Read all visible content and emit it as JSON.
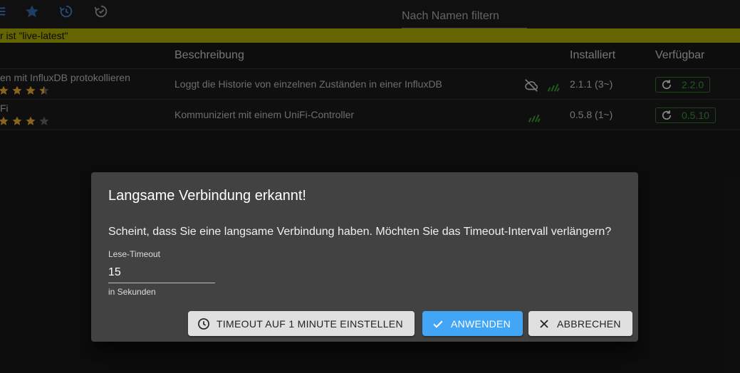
{
  "toolbar": {
    "icons": [
      "menu-icon",
      "star-icon",
      "history-icon",
      "history-check-icon"
    ],
    "filter_placeholder": "Nach Namen filtern"
  },
  "banner": {
    "text": "r ist \"live-latest\""
  },
  "table": {
    "headers": {
      "description": "Beschreibung",
      "installed": "Installiert",
      "available": "Verfügbar"
    },
    "rows": [
      {
        "name": "en mit InfluxDB protokollieren",
        "rating_stars": 4.5,
        "description": "Loggt die Historie von einzelnen Zuständen in einer InfluxDB",
        "icons": [
          "cloud-off-icon",
          "signal-icon"
        ],
        "installed": "2.1.1 (3~)",
        "available": "2.2.0"
      },
      {
        "name": "Fi",
        "rating_stars": 3,
        "description": "Kommuniziert mit einem UniFi-Controller",
        "icons": [
          "signal-icon"
        ],
        "installed": "0.5.8 (1~)",
        "available": "0.5.10"
      }
    ]
  },
  "dialog": {
    "title": "Langsame Verbindung erkannt!",
    "message": "Scheint, dass Sie eine langsame Verbindung haben. Möchten Sie das Timeout-Intervall verlängern?",
    "field": {
      "label": "Lese-Timeout",
      "value": "15",
      "helper": "in Sekunden"
    },
    "buttons": {
      "timeout": "TIMEOUT AUF 1 MINUTE EINSTELLEN",
      "apply": "ANWENDEN",
      "cancel": "ABBRECHEN"
    }
  },
  "colors": {
    "accent_blue": "#42a5f5",
    "banner_yellow": "#9a9a00",
    "star": "#d49a2a",
    "update_green": "#2f8a2f"
  }
}
